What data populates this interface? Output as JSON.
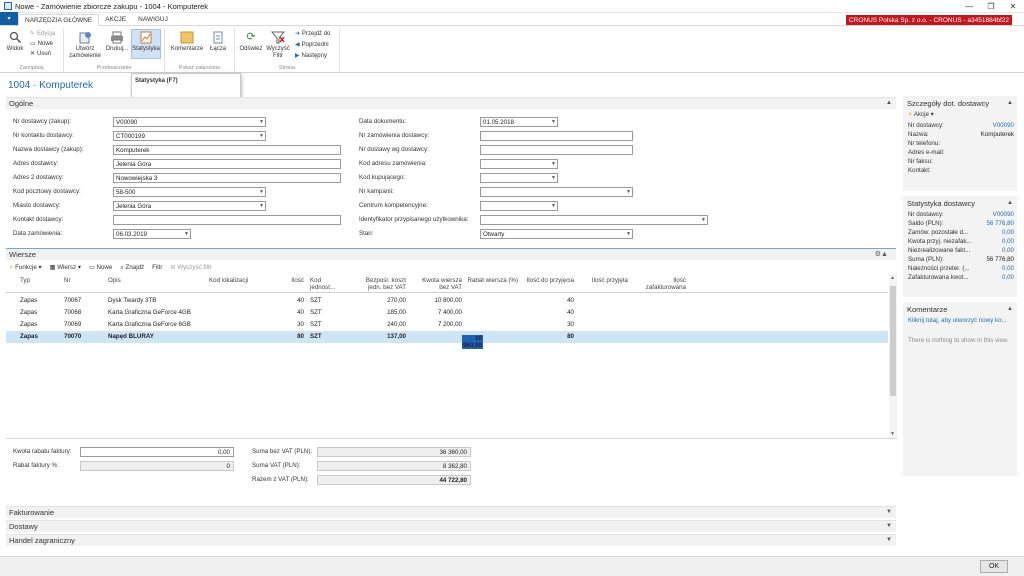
{
  "window": {
    "title": "Nowe - Zamówienie zbiorcze zakupu - 1004 - Komputerek",
    "min": "—",
    "max": "❐",
    "close": "✕"
  },
  "menu": {
    "app_button": "▾",
    "tabs": [
      "NARZĘDZIA GŁÓWNE",
      "AKCJE",
      "NAWIGUJ"
    ],
    "company": "CRONUS Polska Sp. z o.o. - CRONUS - a3451884bf22"
  },
  "ribbon": {
    "widok": "Widok",
    "edycja": "Edycja",
    "nowe": "Nowe",
    "usun": "Usuń",
    "zarzadzaj": "Zarządzaj",
    "utworz": "Utwórz zamówienie",
    "drukuj": "Drukuj...",
    "statystyka": "Statystyka",
    "przetwarzanie": "Przetwarzanie",
    "komentarze": "Komentarze",
    "lacza": "Łącza",
    "pokaz": "Pokaż załączone",
    "odswiez": "Odśwież",
    "wyczysc": "Wyczyść Filtr",
    "przejdz": "Przejdź do",
    "poprzedni": "Poprzedni",
    "nastepny": "Następny",
    "strona": "Strona"
  },
  "tooltip": "Statystyka (F7)",
  "page_title": "1004 · Komputerek",
  "general": {
    "tab": "Ogólne",
    "left": [
      {
        "label": "Nr dostawcy (zakup):",
        "value": "V00090"
      },
      {
        "label": "Nr kontaktu dostawcy:",
        "value": "CT000199"
      },
      {
        "label": "Nazwa dostawcy (zakup):",
        "value": "Komputerek"
      },
      {
        "label": "Adres dostawcy:",
        "value": "Jelenia Góra"
      },
      {
        "label": "Adres 2 dostawcy:",
        "value": "Nowowiejska 3"
      },
      {
        "label": "Kod pocztowy dostawcy:",
        "value": "58-500"
      },
      {
        "label": "Miasto dostawcy:",
        "value": "Jelenia Góra"
      },
      {
        "label": "Kontakt dostawcy:",
        "value": ""
      },
      {
        "label": "Data zamówienia:",
        "value": "06.03.2019"
      }
    ],
    "right": [
      {
        "label": "Data dokumentu:",
        "value": "01.05.2018"
      },
      {
        "label": "Nr zamówienia dostawcy:",
        "value": ""
      },
      {
        "label": "Nr dostawy wg dostawcy:",
        "value": ""
      },
      {
        "label": "Kod adresu zamówienia:",
        "value": ""
      },
      {
        "label": "Kod kupującego:",
        "value": ""
      },
      {
        "label": "Nr kampanii:",
        "value": ""
      },
      {
        "label": "Centrum kompetencyjne:",
        "value": ""
      },
      {
        "label": "Identyfikator przypisanego użytkownika:",
        "value": ""
      },
      {
        "label": "Stan:",
        "value": "Otwarty"
      }
    ]
  },
  "lines": {
    "tab": "Wiersze",
    "tools": {
      "funkcje": "Funkcje",
      "wiersz": "Wiersz",
      "nowe": "Nowe",
      "znajdz": "Znajdź",
      "filtr": "Filtr",
      "wyczysc": "Wyczyść filtr"
    },
    "headers": [
      "Typ",
      "Nr",
      "Opis",
      "Kod lokalizacji",
      "Ilość",
      "Kod jednost...",
      "Bezpośr. koszt jedn. bez VAT",
      "Kwota wiersza bez VAT",
      "Rabat wiersza (%)",
      "Ilość do przyjęcia",
      "Ilość przyjęta",
      "Ilość zafakturowana"
    ],
    "rows": [
      [
        "Zapas",
        "70067",
        "Dysk Twardy 3TB",
        "",
        "40",
        "SZT",
        "270,00",
        "10 800,00",
        "",
        "40",
        "",
        ""
      ],
      [
        "Zapas",
        "70068",
        "Karta Graficzna GeForce 4GB",
        "",
        "40",
        "SZT",
        "185,00",
        "7 400,00",
        "",
        "40",
        "",
        ""
      ],
      [
        "Zapas",
        "70069",
        "Karta Graficzna GeForce 6GB",
        "",
        "30",
        "SZT",
        "240,00",
        "7 200,00",
        "",
        "30",
        "",
        ""
      ],
      [
        "Zapas",
        "70070",
        "Napęd BLURAY",
        "",
        "80",
        "SZT",
        "137,00",
        "10 960,00",
        "",
        "80",
        "",
        ""
      ]
    ]
  },
  "totals": {
    "kwota_rabatu_label": "Kwota rabatu faktury:",
    "kwota_rabatu": "0,00",
    "rabat_proc_label": "Rabat faktury %:",
    "rabat_proc": "0",
    "suma_bez_label": "Suma bez VAT (PLN):",
    "suma_bez": "36 360,00",
    "suma_vat_label": "Suma VAT (PLN):",
    "suma_vat": "8 362,80",
    "razem_label": "Razem z VAT (PLN):",
    "razem": "44 722,80"
  },
  "sections": [
    "Fakturowanie",
    "Dostawy",
    "Handel zagraniczny"
  ],
  "factbox": {
    "szczegoly_title": "Szczegóły dot. dostawcy",
    "akcje": "Akcje",
    "szczegoly": [
      {
        "label": "Nr dostawcy:",
        "value": "V00090",
        "link": true
      },
      {
        "label": "Nazwa:",
        "value": "Komputerek",
        "link": false
      },
      {
        "label": "Nr telefonu:",
        "value": "",
        "link": false
      },
      {
        "label": "Adres e-mail:",
        "value": "",
        "link": false
      },
      {
        "label": "Nr faksu:",
        "value": "",
        "link": false
      },
      {
        "label": "Kontakt:",
        "value": "",
        "link": false
      }
    ],
    "statystyka_title": "Statystyka dostawcy",
    "statystyka": [
      {
        "label": "Nr dostawcy:",
        "value": "V00090"
      },
      {
        "label": "Saldo (PLN):",
        "value": "56 776,80"
      },
      {
        "label": "Zamów. pozostałe d...",
        "value": "0,00"
      },
      {
        "label": "Kwota przyj. niezafak...",
        "value": "0,00"
      },
      {
        "label": "Niezrealizowane fakt...",
        "value": "0,00"
      },
      {
        "label": "Suma (PLN):",
        "value": "56 776,80",
        "dark": true
      },
      {
        "label": "Należności przeter. (...",
        "value": "0,00"
      },
      {
        "label": "Zafakturowana kwot...",
        "value": "0,00"
      }
    ],
    "komentarze_title": "Komentarze",
    "komentarze_link": "Kliknij tutaj, aby utworzyć nowy ko...",
    "komentarze_empty": "There is nothing to show in this view."
  },
  "ok": "OK"
}
